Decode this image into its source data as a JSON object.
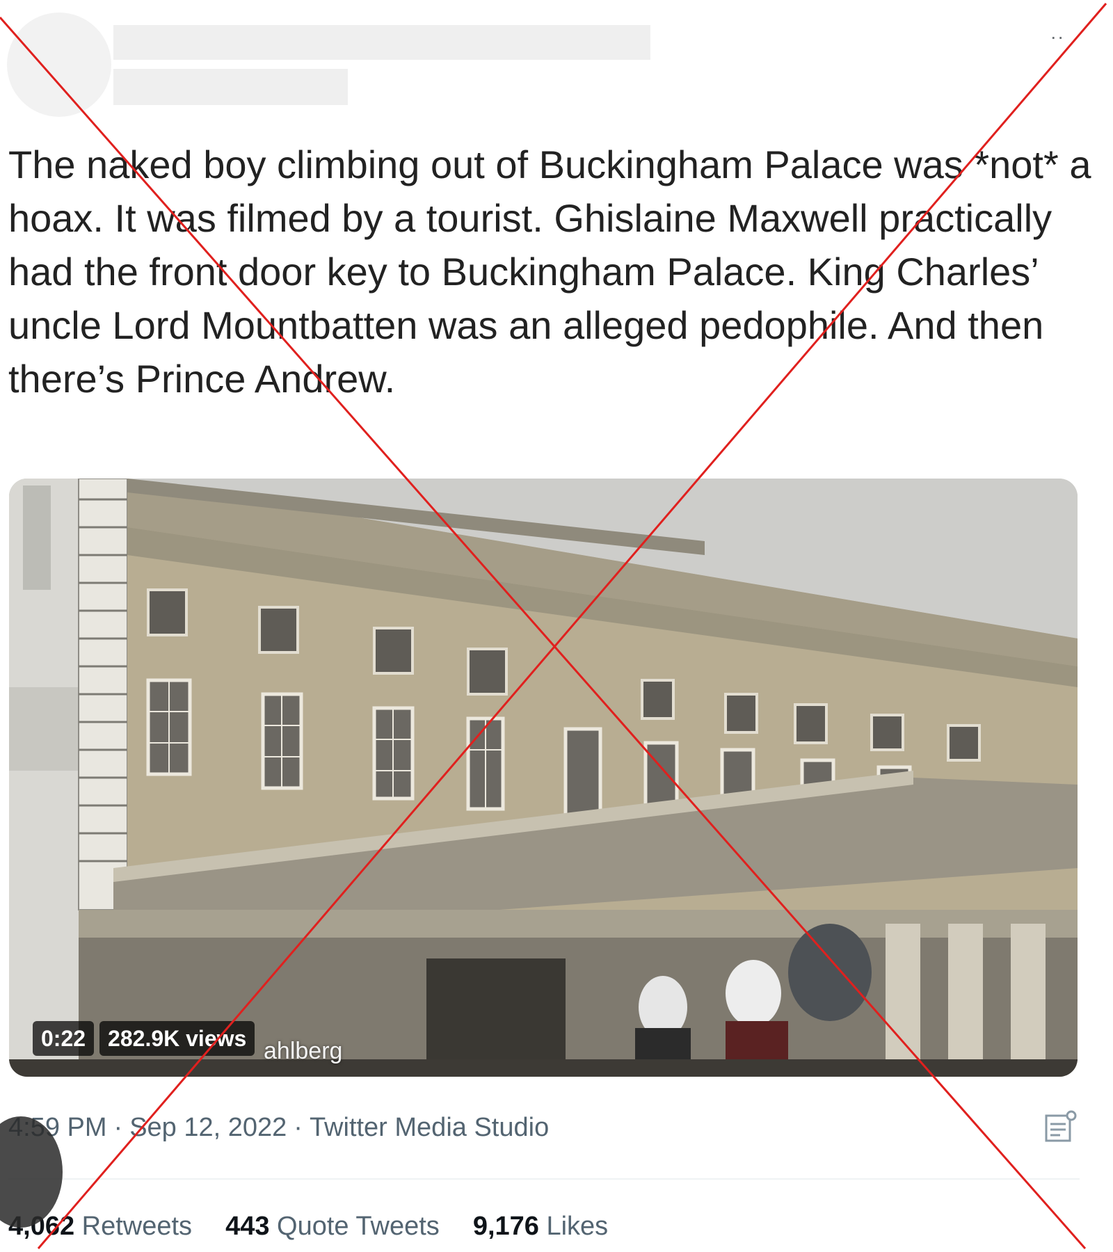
{
  "tweet": {
    "text": "The naked boy climbing out of Buckingham Palace was *not* a hoax. It was filmed by a tourist. Ghislaine Maxwell practically had the front door key to Buckingham Palace. King Charles’ uncle Lord Mountbatten was an alleged pedophile. And then there’s Prince Andrew.",
    "more_label": "··",
    "video": {
      "duration": "0:22",
      "views": "282.9K views",
      "watermark": "ahlberg"
    },
    "time": "4:59 PM",
    "date": "Sep 12, 2022",
    "source": "Twitter Media Studio",
    "separator": "·",
    "stats": {
      "retweets_count": "4,062",
      "retweets_label": "Retweets",
      "quotes_count": "443",
      "quotes_label": "Quote Tweets",
      "likes_count": "9,176",
      "likes_label": "Likes"
    }
  },
  "icons": {
    "more": "more-dots-icon",
    "analytics": "analytics-icon"
  },
  "colors": {
    "overlay_x": "#e0201e",
    "text_primary": "#222222",
    "text_secondary": "#536471",
    "redaction": "#efefef"
  }
}
